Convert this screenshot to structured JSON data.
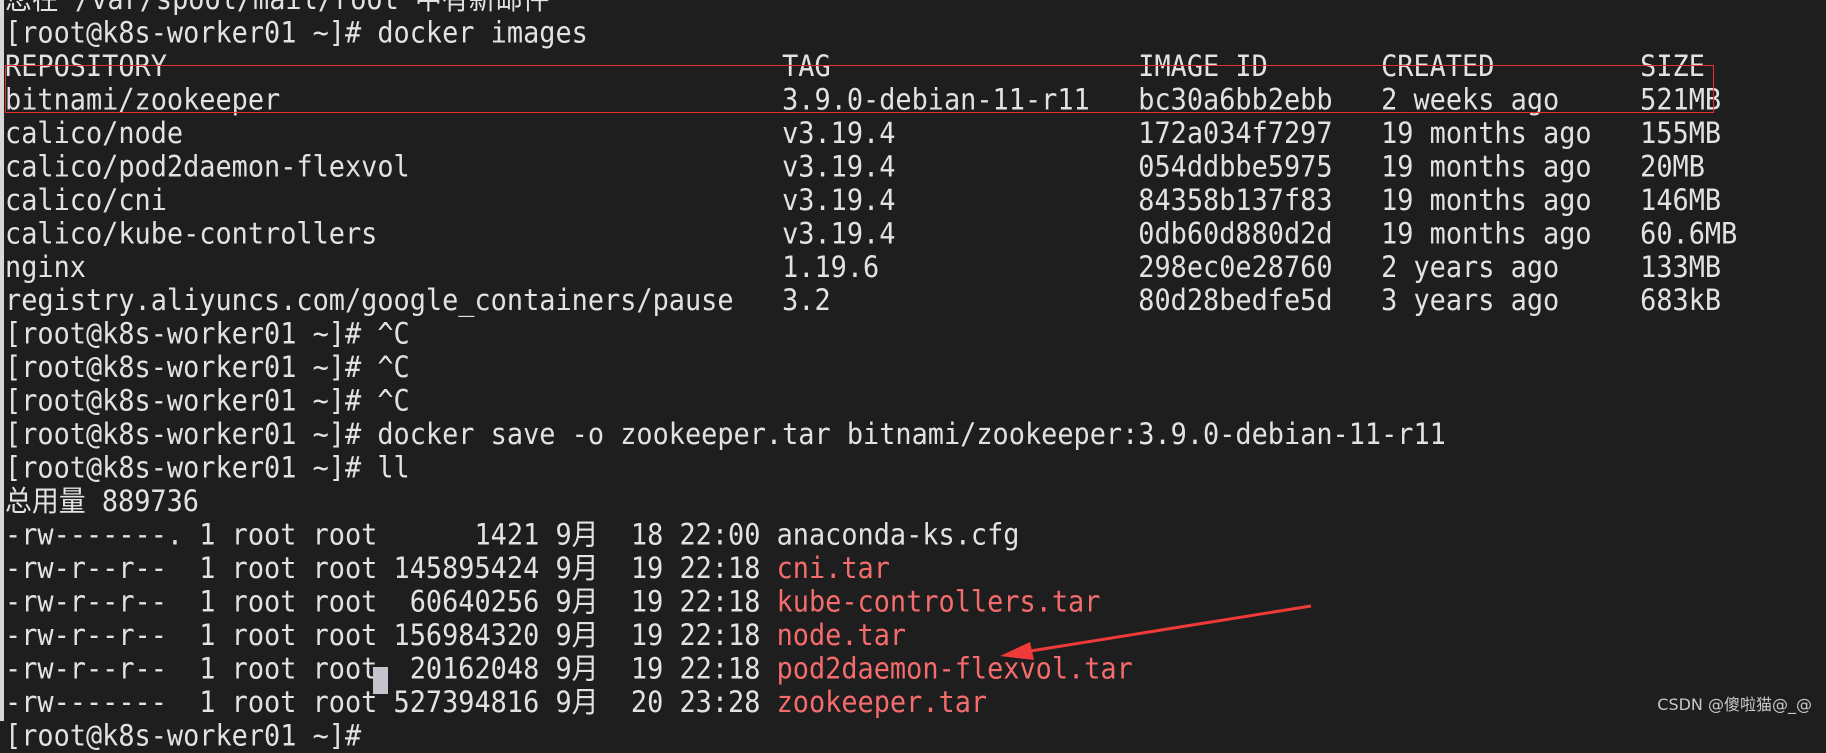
{
  "terminal": {
    "lines": [
      {
        "text": "您在 /var/spool/mail/root 中有新邮件"
      },
      {
        "text": "[root@k8s-worker01 ~]# docker images"
      },
      {
        "text": "REPOSITORY                                      TAG                   IMAGE ID       CREATED         SIZE"
      },
      {
        "text": "bitnami/zookeeper                               3.9.0-debian-11-r11   bc30a6bb2ebb   2 weeks ago     521MB"
      },
      {
        "text": "calico/node                                     v3.19.4               172a034f7297   19 months ago   155MB"
      },
      {
        "text": "calico/pod2daemon-flexvol                       v3.19.4               054ddbbe5975   19 months ago   20MB"
      },
      {
        "text": "calico/cni                                      v3.19.4               84358b137f83   19 months ago   146MB"
      },
      {
        "text": "calico/kube-controllers                         v3.19.4               0db60d880d2d   19 months ago   60.6MB"
      },
      {
        "text": "nginx                                           1.19.6                298ec0e28760   2 years ago     133MB"
      },
      {
        "text": "registry.aliyuncs.com/google_containers/pause   3.2                   80d28bedfe5d   3 years ago     683kB"
      },
      {
        "text": "[root@k8s-worker01 ~]# ^C"
      },
      {
        "text": "[root@k8s-worker01 ~]# ^C"
      },
      {
        "text": "[root@k8s-worker01 ~]# ^C"
      },
      {
        "text": "[root@k8s-worker01 ~]# docker save -o zookeeper.tar bitnami/zookeeper:3.9.0-debian-11-r11"
      },
      {
        "text": "[root@k8s-worker01 ~]# ll"
      },
      {
        "text": "总用量 889736"
      },
      {
        "text": "-rw-------. 1 root root      1421 9月  18 22:00 ",
        "file": "anaconda-ks.cfg",
        "file_color": "default"
      },
      {
        "text": "-rw-r--r--  1 root root 145895424 9月  19 22:18 ",
        "file": "cni.tar",
        "file_color": "red"
      },
      {
        "text": "-rw-r--r--  1 root root  60640256 9月  19 22:18 ",
        "file": "kube-controllers.tar",
        "file_color": "red"
      },
      {
        "text": "-rw-r--r--  1 root root 156984320 9月  19 22:18 ",
        "file": "node.tar",
        "file_color": "red"
      },
      {
        "text": "-rw-r--r--  1 root root  20162048 9月  19 22:18 ",
        "file": "pod2daemon-flexvol.tar",
        "file_color": "red"
      },
      {
        "text": "-rw-------  1 root root 527394816 9月  20 23:28 ",
        "file": "zookeeper.tar",
        "file_color": "red"
      },
      {
        "text": "[root@k8s-worker01 ~]# "
      }
    ]
  },
  "watermark": "CSDN @傻啦猫@_@",
  "colors": {
    "background": "#1e1e1e",
    "text": "#e2e2e2",
    "archive_file": "#f46c6c",
    "annotation": "#e8302f",
    "cursor": "#c4c4cc"
  },
  "annotations": {
    "highlight_box": "bitnami/zookeeper row",
    "arrow_icon": "arrow pointing to zookeeper.tar"
  }
}
